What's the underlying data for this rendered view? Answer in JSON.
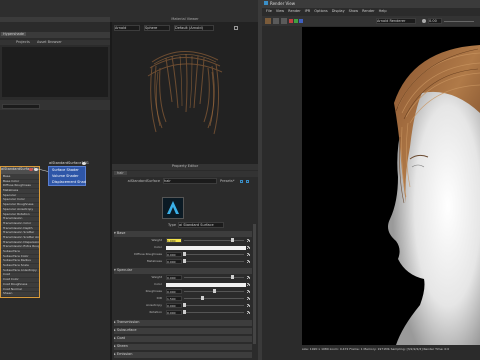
{
  "left_window": {
    "tabs": [
      "Hypershade"
    ],
    "browser_tabs": [
      "Projects",
      "Asset Browser"
    ],
    "shader_node": {
      "title": "aiStandardSurface1",
      "attributes": [
        "Base",
        "Base Color",
        "Diffuse Roughness",
        "Metalness",
        "Specular",
        "Specular Color",
        "Specular Roughness",
        "Specular Anisotropy",
        "Specular Rotation",
        "Transmission",
        "Transmission Color",
        "Transmission Depth",
        "Transmission Scatter",
        "Transmission Scatter Anisotropy",
        "Transmission Dispersion",
        "Transmission Extra Roughness",
        "Subsurface",
        "Subsurface Color",
        "Subsurface Radius",
        "Subsurface Scale",
        "Subsurface Anisotropy",
        "Coat",
        "Coat Color",
        "Coat Roughness",
        "Coat Normal",
        "Sheen",
        "Sheen Color",
        "Sheen Roughness",
        "Thin Walled",
        "Emission",
        "Emission Color",
        "Opacity",
        "Normal Camera"
      ]
    },
    "sg_node": {
      "title": "aiStandardSurface1SG",
      "inputs": [
        "Surface Shader",
        "Volume Shader",
        "Displacement Shader"
      ]
    },
    "viewport": {
      "title": "Material Viewer",
      "renderer": "Arnold",
      "geometry": "Sphere",
      "lighting": "Default (Arnold)"
    },
    "property_editor": {
      "title": "Property Editor",
      "tab": "hair",
      "node_type": "aiStandardSurface",
      "node_name": "hair",
      "presets_label": "Presets*",
      "type_label": "Type",
      "type_value": "ai Standard Surface",
      "base_section": "Base",
      "base_rows": [
        {
          "label": "Weight",
          "value": "1.000",
          "fill": 0.8
        },
        {
          "label": "Color",
          "value": "",
          "fill": 0
        },
        {
          "label": "Diffuse Roughness",
          "value": "0.000",
          "fill": 0
        },
        {
          "label": "Metalness",
          "value": "0.000",
          "fill": 0
        }
      ],
      "specular_section": "Specular",
      "specular_rows": [
        {
          "label": "Weight",
          "value": "0.000",
          "fill": 0.8
        },
        {
          "label": "Color",
          "value": "",
          "fill": 0
        },
        {
          "label": "Roughness",
          "value": "0.000",
          "fill": 0.5
        },
        {
          "label": "IOR",
          "value": "1.500",
          "fill": 0.3
        },
        {
          "label": "Anisotropy",
          "value": "0.000",
          "fill": 0
        },
        {
          "label": "Rotation",
          "value": "0.000",
          "fill": 0
        }
      ],
      "collapsed_sections": [
        "Transmission",
        "Subsurface",
        "Coat",
        "Sheen",
        "Emission"
      ]
    }
  },
  "render_view": {
    "title": "Render View",
    "menu": [
      "File",
      "View",
      "Render",
      "IPR",
      "Options",
      "Display",
      "Show",
      "Render",
      "Help"
    ],
    "camera": "Arnold Renderer",
    "exposure": "0.00",
    "status": "size: 1920 x 1080 zoom: 0.472     Frame: 1   Memory: 1971Mb   Sampling: [3/2/2/2/2]   Render Time: 0:0"
  },
  "colors": {
    "accent": "#3a8fc8",
    "node_blue": "#2e56a8",
    "node_orange": "#d89a3a",
    "weight_swatch": "#f3e24a"
  }
}
